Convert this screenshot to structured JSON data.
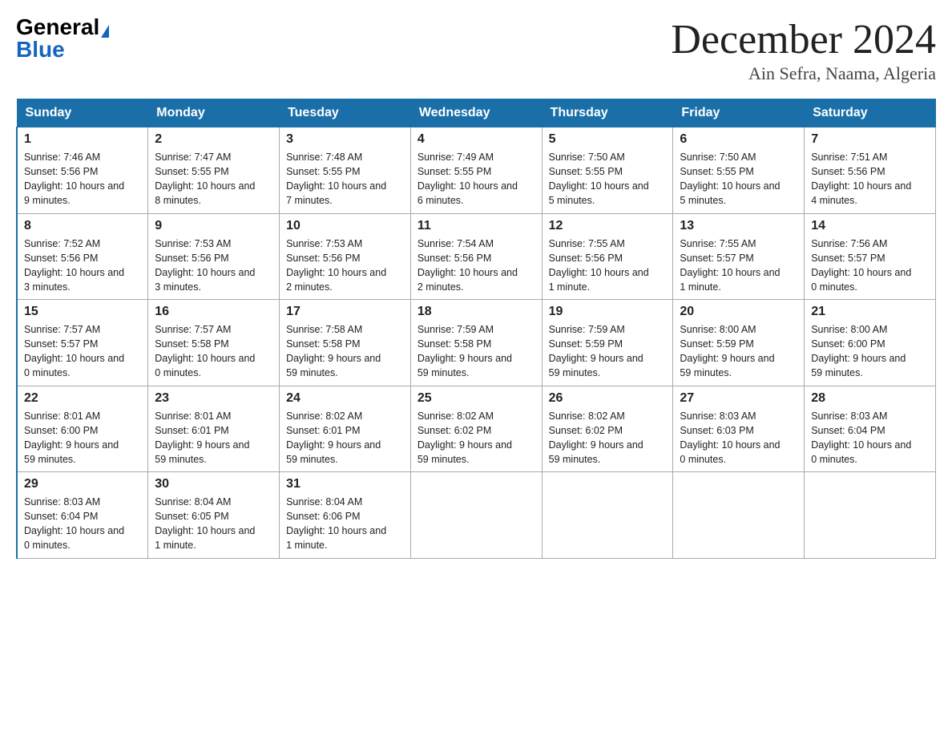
{
  "header": {
    "logo_general": "General",
    "logo_blue": "Blue",
    "month_title": "December 2024",
    "location": "Ain Sefra, Naama, Algeria"
  },
  "days_of_week": [
    "Sunday",
    "Monday",
    "Tuesday",
    "Wednesday",
    "Thursday",
    "Friday",
    "Saturday"
  ],
  "weeks": [
    [
      {
        "day": "1",
        "sunrise": "7:46 AM",
        "sunset": "5:56 PM",
        "daylight": "10 hours and 9 minutes."
      },
      {
        "day": "2",
        "sunrise": "7:47 AM",
        "sunset": "5:55 PM",
        "daylight": "10 hours and 8 minutes."
      },
      {
        "day": "3",
        "sunrise": "7:48 AM",
        "sunset": "5:55 PM",
        "daylight": "10 hours and 7 minutes."
      },
      {
        "day": "4",
        "sunrise": "7:49 AM",
        "sunset": "5:55 PM",
        "daylight": "10 hours and 6 minutes."
      },
      {
        "day": "5",
        "sunrise": "7:50 AM",
        "sunset": "5:55 PM",
        "daylight": "10 hours and 5 minutes."
      },
      {
        "day": "6",
        "sunrise": "7:50 AM",
        "sunset": "5:55 PM",
        "daylight": "10 hours and 5 minutes."
      },
      {
        "day": "7",
        "sunrise": "7:51 AM",
        "sunset": "5:56 PM",
        "daylight": "10 hours and 4 minutes."
      }
    ],
    [
      {
        "day": "8",
        "sunrise": "7:52 AM",
        "sunset": "5:56 PM",
        "daylight": "10 hours and 3 minutes."
      },
      {
        "day": "9",
        "sunrise": "7:53 AM",
        "sunset": "5:56 PM",
        "daylight": "10 hours and 3 minutes."
      },
      {
        "day": "10",
        "sunrise": "7:53 AM",
        "sunset": "5:56 PM",
        "daylight": "10 hours and 2 minutes."
      },
      {
        "day": "11",
        "sunrise": "7:54 AM",
        "sunset": "5:56 PM",
        "daylight": "10 hours and 2 minutes."
      },
      {
        "day": "12",
        "sunrise": "7:55 AM",
        "sunset": "5:56 PM",
        "daylight": "10 hours and 1 minute."
      },
      {
        "day": "13",
        "sunrise": "7:55 AM",
        "sunset": "5:57 PM",
        "daylight": "10 hours and 1 minute."
      },
      {
        "day": "14",
        "sunrise": "7:56 AM",
        "sunset": "5:57 PM",
        "daylight": "10 hours and 0 minutes."
      }
    ],
    [
      {
        "day": "15",
        "sunrise": "7:57 AM",
        "sunset": "5:57 PM",
        "daylight": "10 hours and 0 minutes."
      },
      {
        "day": "16",
        "sunrise": "7:57 AM",
        "sunset": "5:58 PM",
        "daylight": "10 hours and 0 minutes."
      },
      {
        "day": "17",
        "sunrise": "7:58 AM",
        "sunset": "5:58 PM",
        "daylight": "9 hours and 59 minutes."
      },
      {
        "day": "18",
        "sunrise": "7:59 AM",
        "sunset": "5:58 PM",
        "daylight": "9 hours and 59 minutes."
      },
      {
        "day": "19",
        "sunrise": "7:59 AM",
        "sunset": "5:59 PM",
        "daylight": "9 hours and 59 minutes."
      },
      {
        "day": "20",
        "sunrise": "8:00 AM",
        "sunset": "5:59 PM",
        "daylight": "9 hours and 59 minutes."
      },
      {
        "day": "21",
        "sunrise": "8:00 AM",
        "sunset": "6:00 PM",
        "daylight": "9 hours and 59 minutes."
      }
    ],
    [
      {
        "day": "22",
        "sunrise": "8:01 AM",
        "sunset": "6:00 PM",
        "daylight": "9 hours and 59 minutes."
      },
      {
        "day": "23",
        "sunrise": "8:01 AM",
        "sunset": "6:01 PM",
        "daylight": "9 hours and 59 minutes."
      },
      {
        "day": "24",
        "sunrise": "8:02 AM",
        "sunset": "6:01 PM",
        "daylight": "9 hours and 59 minutes."
      },
      {
        "day": "25",
        "sunrise": "8:02 AM",
        "sunset": "6:02 PM",
        "daylight": "9 hours and 59 minutes."
      },
      {
        "day": "26",
        "sunrise": "8:02 AM",
        "sunset": "6:02 PM",
        "daylight": "9 hours and 59 minutes."
      },
      {
        "day": "27",
        "sunrise": "8:03 AM",
        "sunset": "6:03 PM",
        "daylight": "10 hours and 0 minutes."
      },
      {
        "day": "28",
        "sunrise": "8:03 AM",
        "sunset": "6:04 PM",
        "daylight": "10 hours and 0 minutes."
      }
    ],
    [
      {
        "day": "29",
        "sunrise": "8:03 AM",
        "sunset": "6:04 PM",
        "daylight": "10 hours and 0 minutes."
      },
      {
        "day": "30",
        "sunrise": "8:04 AM",
        "sunset": "6:05 PM",
        "daylight": "10 hours and 1 minute."
      },
      {
        "day": "31",
        "sunrise": "8:04 AM",
        "sunset": "6:06 PM",
        "daylight": "10 hours and 1 minute."
      },
      null,
      null,
      null,
      null
    ]
  ],
  "labels": {
    "sunrise": "Sunrise:",
    "sunset": "Sunset:",
    "daylight": "Daylight:"
  }
}
